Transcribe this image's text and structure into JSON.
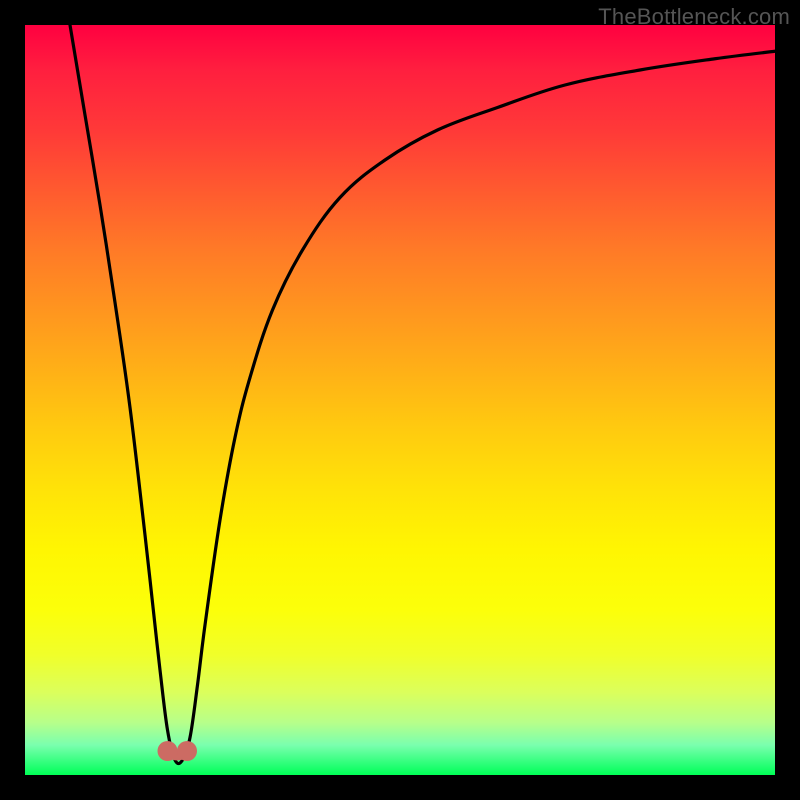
{
  "watermark": "TheBottleneck.com",
  "chart_data": {
    "type": "line",
    "title": "",
    "xlabel": "",
    "ylabel": "",
    "xlim": [
      0,
      100
    ],
    "ylim": [
      0,
      100
    ],
    "series": [
      {
        "name": "bottleneck-curve",
        "x": [
          6,
          8,
          10,
          12,
          14,
          16,
          17,
          18,
          19,
          20,
          21,
          22,
          23,
          24,
          26,
          28,
          30,
          33,
          37,
          42,
          48,
          55,
          63,
          72,
          82,
          92,
          100
        ],
        "values": [
          100,
          88,
          76,
          63,
          49,
          32,
          23,
          14,
          6,
          2,
          2,
          5,
          12,
          20,
          34,
          45,
          53,
          62,
          70,
          77,
          82,
          86,
          89,
          92,
          94,
          95.5,
          96.5
        ]
      }
    ],
    "markers": [
      {
        "name": "left-dot",
        "x": 19.0,
        "y": 3.2
      },
      {
        "name": "right-dot",
        "x": 21.6,
        "y": 3.2
      }
    ],
    "gradient_stops": [
      {
        "pos": 0,
        "color": "#ff0040"
      },
      {
        "pos": 50,
        "color": "#ffcc00"
      },
      {
        "pos": 80,
        "color": "#ffff00"
      },
      {
        "pos": 100,
        "color": "#00ff55"
      }
    ]
  }
}
